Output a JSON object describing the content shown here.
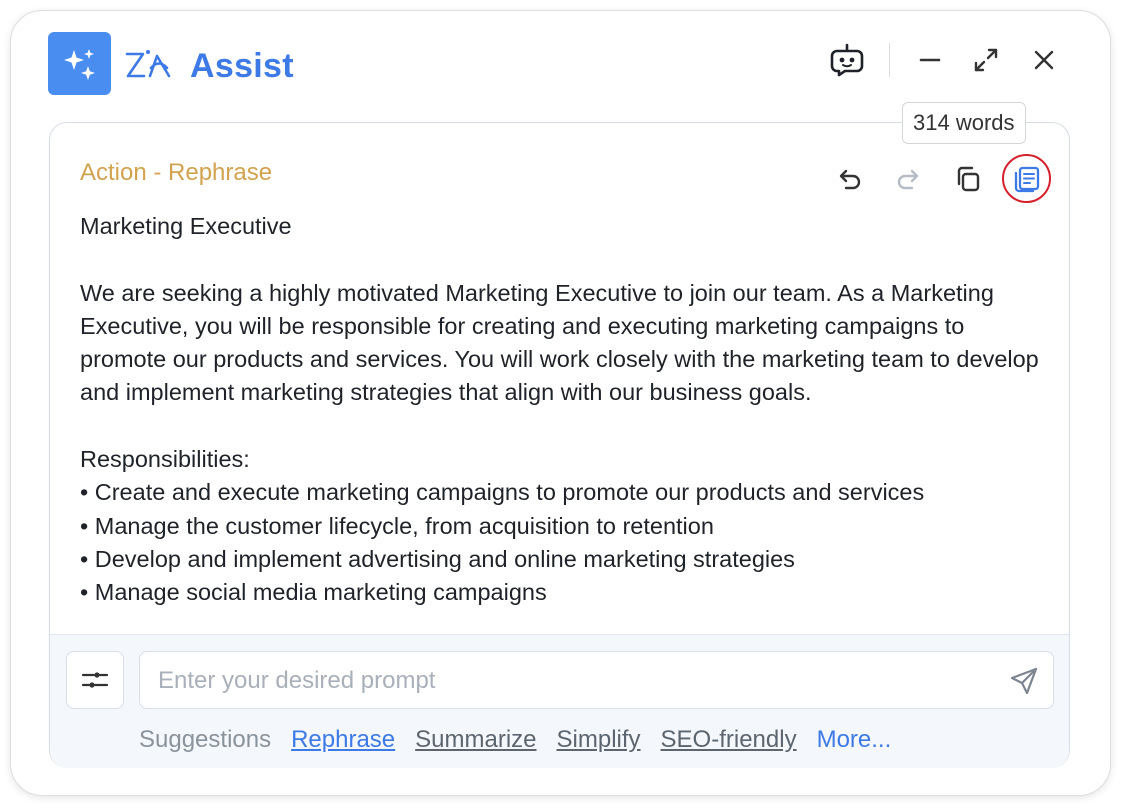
{
  "header": {
    "title": "Assist",
    "buttons": [
      "bot-icon",
      "minimize-icon",
      "expand-icon",
      "close-icon"
    ]
  },
  "result": {
    "action_label": "Action - Rephrase",
    "word_count": "314 words",
    "title": "Marketing Executive",
    "intro": "We are seeking a highly motivated Marketing Executive to join our team. As a Marketing Executive, you will be responsible for creating and executing marketing campaigns to promote our products and services. You will work closely with the marketing team to develop and implement marketing strategies that align with our business goals.",
    "section_heading": "Responsibilities:",
    "bullets": [
      "Create and execute marketing campaigns to promote our products and services",
      "Manage the customer lifecycle, from acquisition to retention",
      "Develop and implement advertising and online marketing strategies",
      "Manage social media marketing campaigns"
    ]
  },
  "prompt": {
    "placeholder": "Enter your desired prompt",
    "value": ""
  },
  "suggestions": {
    "label": "Suggestions",
    "items": [
      "Rephrase",
      "Summarize",
      "Simplify",
      "SEO-friendly"
    ],
    "more": "More..."
  },
  "colors": {
    "accent": "#3d7ae6",
    "action_label": "#d3a24f",
    "highlight_ring": "#d6202c"
  }
}
